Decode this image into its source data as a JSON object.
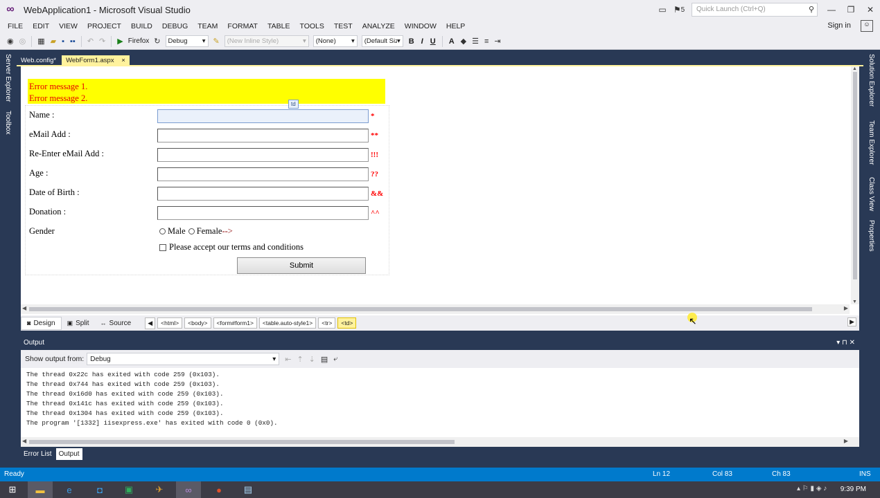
{
  "window": {
    "title": "WebApplication1 - Microsoft Visual Studio",
    "notification_count": "5",
    "quick_launch_placeholder": "Quick Launch (Ctrl+Q)",
    "signin": "Sign in"
  },
  "menu": [
    "FILE",
    "EDIT",
    "VIEW",
    "PROJECT",
    "BUILD",
    "DEBUG",
    "TEAM",
    "FORMAT",
    "TABLE",
    "TOOLS",
    "TEST",
    "ANALYZE",
    "WINDOW",
    "HELP"
  ],
  "toolbar": {
    "run_target": "Firefox",
    "configuration": "Debug",
    "style_combo": "(New Inline Style)",
    "block_format": "(None)",
    "font_size": "(Default Size)",
    "bold": "B",
    "italic": "I",
    "underline": "U",
    "font_color": "A"
  },
  "left_strip": [
    "Server Explorer",
    "Toolbox"
  ],
  "right_strip": [
    "Solution Explorer",
    "Team Explorer",
    "Class View",
    "Properties"
  ],
  "doc_tabs": [
    {
      "label": "Web.config*",
      "active": false
    },
    {
      "label": "WebForm1.aspx",
      "active": true,
      "close": "×"
    }
  ],
  "design": {
    "errors": [
      "Error message 1.",
      "Error message 2."
    ],
    "td_tag": "td",
    "fields": [
      {
        "label": "Name :",
        "validator": "*"
      },
      {
        "label": "eMail Add :",
        "validator": "**"
      },
      {
        "label": "Re-Enter eMail Add :",
        "validator": "!!!"
      },
      {
        "label": "Age :",
        "validator": "??"
      },
      {
        "label": "Date of Birth :",
        "validator": "&&"
      },
      {
        "label": "Donation :",
        "validator": "^^"
      }
    ],
    "gender_label": "Gender",
    "gender_options": [
      "Male",
      "Female"
    ],
    "gender_marker": "-->",
    "terms_label": "Please accept our terms and conditions",
    "submit_label": "Submit"
  },
  "view_bar": {
    "tabs": [
      {
        "label": "Design",
        "icon": "◙",
        "active": true
      },
      {
        "label": "Split",
        "icon": "▣",
        "active": false
      },
      {
        "label": "Source",
        "icon": "↔",
        "active": false
      }
    ],
    "breadcrumbs": [
      "<html>",
      "<body>",
      "<form#form1>",
      "<table.auto-style1>",
      "<tr>",
      "<td>"
    ]
  },
  "output": {
    "title": "Output",
    "show_from_label": "Show output from:",
    "show_from_value": "Debug",
    "lines": [
      "The thread 0x22c has exited with code 259 (0x103).",
      "The thread 0x744 has exited with code 259 (0x103).",
      "The thread 0x16d0 has exited with code 259 (0x103).",
      "The thread 0x141c has exited with code 259 (0x103).",
      "The thread 0x1304 has exited with code 259 (0x103).",
      "The program '[1332] iisexpress.exe' has exited with code 0 (0x0)."
    ]
  },
  "bottom_tabs": [
    {
      "label": "Error List",
      "active": false
    },
    {
      "label": "Output",
      "active": true
    }
  ],
  "status": {
    "left": "Ready",
    "line": "Ln 12",
    "col": "Col 83",
    "ch": "Ch 83",
    "mode": "INS"
  },
  "taskbar": {
    "time": "9:39 PM"
  },
  "colors": {
    "vs_purple": "#68217a",
    "vs_blue": "#007acc",
    "frame_navy": "#293955",
    "active_tab": "#fff29d",
    "error_bg": "#ffff00",
    "error_text": "#e60000"
  }
}
